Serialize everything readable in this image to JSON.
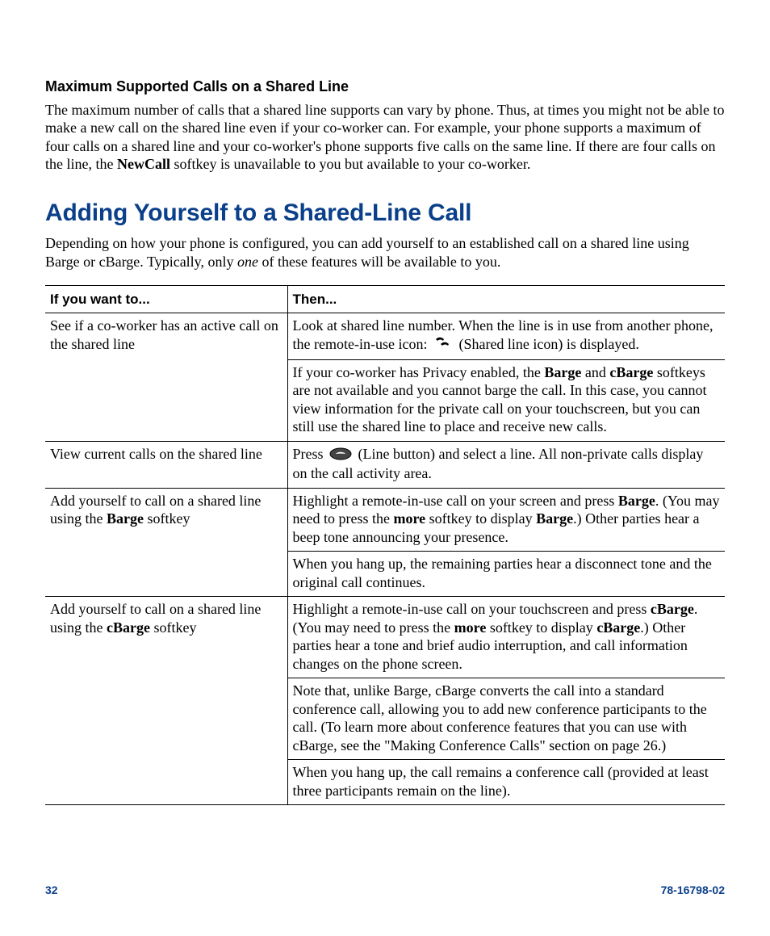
{
  "section1": {
    "title": "Maximum Supported Calls on a Shared Line",
    "para_before": "The maximum number of calls that a shared line supports can vary by phone. Thus, at times you might not be able to make a new call on the shared line even if your co-worker can. For example, your phone supports a maximum of four calls on a shared line and your co-worker's phone supports five calls on the same line. If there are four calls on the line, the ",
    "newcall": "NewCall",
    "para_after": " softkey is unavailable to you but available to your co-worker."
  },
  "section2": {
    "title": "Adding Yourself to a Shared-Line Call",
    "intro_before": "Depending on how your phone is configured, you can add yourself to an established call on a shared line using Barge or cBarge. Typically, only ",
    "intro_em": "one",
    "intro_after": " of these features will be available to you."
  },
  "table": {
    "header1": "If you want to...",
    "header2": "Then...",
    "r1": {
      "if": "See if a co-worker has an active call on the shared line",
      "then1a": "Look at shared line number. When the line is in use from another phone, the remote-in-use icon: ",
      "then1b": " (Shared line icon) is displayed.",
      "then2a": "If your co-worker has Privacy enabled, the ",
      "barge": "Barge",
      "and": " and ",
      "cbarge": "cBarge",
      "then2b": " softkeys are not available and you cannot barge the call. In this case, you cannot view information for the private call on your touchscreen, but you can still use the shared line to place and receive new calls."
    },
    "r2": {
      "if": "View current calls on the shared line",
      "then_a": "Press ",
      "then_b": " (Line button) and select a line. All non-private calls display on the call activity area."
    },
    "r3": {
      "if_a": "Add yourself to call on a shared line using the ",
      "if_bold": "Barge",
      "if_b": " softkey",
      "then1a": "Highlight a remote-in-use call on your screen and press ",
      "barge": "Barge",
      "then1b": ". (You may need to press the ",
      "more": "more",
      "then1c": " softkey to display ",
      "barge2": "Barge",
      "then1d": ".) Other parties hear a beep tone announcing your presence.",
      "then2": "When you hang up, the remaining parties hear a disconnect tone and the original call continues."
    },
    "r4": {
      "if_a": "Add yourself to call on a shared line using the ",
      "if_bold": "cBarge",
      "if_b": " softkey",
      "then1a": "Highlight a remote-in-use call on your touchscreen and press ",
      "cbarge": "cBarge",
      "then1b": ". (You may need to press the ",
      "more": "more",
      "then1c": " softkey to display ",
      "cbarge2": "cBarge",
      "then1d": ".) Other parties hear a tone and brief audio interruption, and call information changes on the phone screen.",
      "then2": "Note that, unlike Barge, cBarge converts the call into a standard conference call, allowing you to add new conference participants to the call. (To learn more about conference features that you can use with cBarge, see the \"Making Conference Calls\" section on page 26.)",
      "then3": "When you hang up, the call remains a conference call (provided at least three participants remain on the line)."
    }
  },
  "footer": {
    "page": "32",
    "docnum": "78-16798-02"
  }
}
